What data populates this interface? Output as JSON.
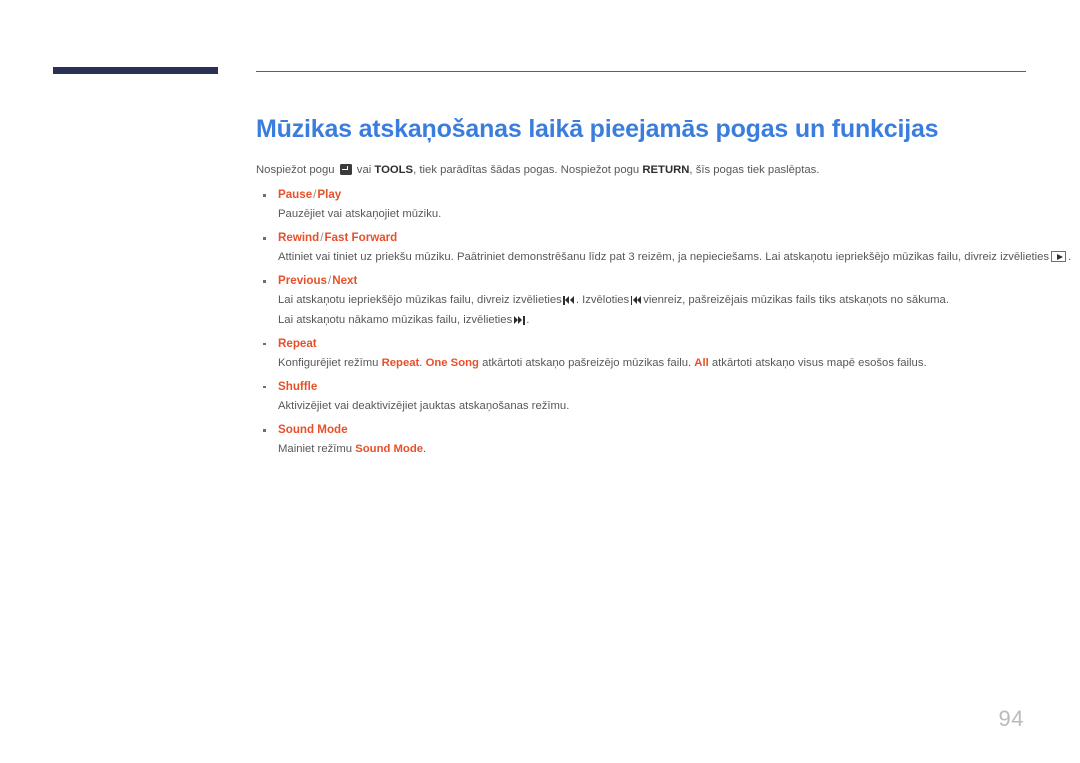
{
  "header": {
    "bar_color": "#2b3154",
    "rule_color": "#5a5f78"
  },
  "title": "Mūzikas atskaņošanas laikā pieejamās pogas un funkcijas",
  "title_color": "#3b7ddd",
  "heading_color": "#e8502a",
  "intro": {
    "part1": "Nospiežot pogu",
    "enter_icon": "enter-key-icon",
    "part2": "vai",
    "tools_label": "TOOLS",
    "part3": ", tiek parādītas šādas pogas. Nospiežot pogu",
    "return_label": "RETURN",
    "part4": ", šīs pogas tiek paslēptas."
  },
  "items": [
    {
      "name": "pause-play",
      "label_main": "Pause",
      "separator": "/",
      "label_alt": "Play",
      "lines": [
        {
          "text": "Pauzējiet vai atskaņojiet mūziku."
        }
      ]
    },
    {
      "name": "rewind-fast-forward",
      "label_main": "Rewind",
      "separator": "/",
      "label_alt": "Fast Forward",
      "lines": [
        {
          "text_before": "Attiniet vai tiniet uz priekšu mūziku. Paātriniet demonstrēšanu līdz pat 3 reizēm, ja nepieciešams. Lai atskaņotu iepriekšējo mūzikas failu, divreiz izvēlieties",
          "icon": "play-button-icon",
          "text_after": "."
        }
      ]
    },
    {
      "name": "previous-next",
      "label_main": "Previous",
      "separator": "/",
      "label_alt": "Next",
      "lines": [
        {
          "text_before": "Lai atskaņotu iepriekšējo mūzikas failu, divreiz izvēlieties",
          "icon": "skip-previous-icon",
          "text_middle": ". Izvēloties",
          "icon2": "skip-previous-icon",
          "text_after": "vienreiz, pašreizējais mūzikas fails tiks atskaņots no sākuma."
        },
        {
          "text_before": "Lai atskaņotu nākamo mūzikas failu, izvēlieties",
          "icon": "skip-next-icon",
          "text_after": "."
        }
      ]
    },
    {
      "name": "repeat",
      "label_main": "Repeat",
      "separator": "",
      "label_alt": "",
      "lines": [
        {
          "text_before": "Konfigurējiet režīmu",
          "bold1": "Repeat",
          "text_mid1": ".",
          "bold2": "One Song",
          "text_mid2": "atkārtoti atskaņo pašreizējo mūzikas failu.",
          "bold3": "All",
          "text_after": "atkārtoti atskaņo visus mapē esošos failus."
        }
      ]
    },
    {
      "name": "shuffle",
      "label_main": "Shuffle",
      "separator": "",
      "label_alt": "",
      "lines": [
        {
          "text": "Aktivizējiet vai deaktivizējiet jauktas atskaņošanas režīmu."
        }
      ]
    },
    {
      "name": "sound-mode",
      "label_main": "Sound Mode",
      "separator": "",
      "label_alt": "",
      "lines": [
        {
          "text_before": "Mainiet režīmu",
          "bold1": "Sound Mode",
          "text_after": "."
        }
      ]
    }
  ],
  "page_number": "94"
}
